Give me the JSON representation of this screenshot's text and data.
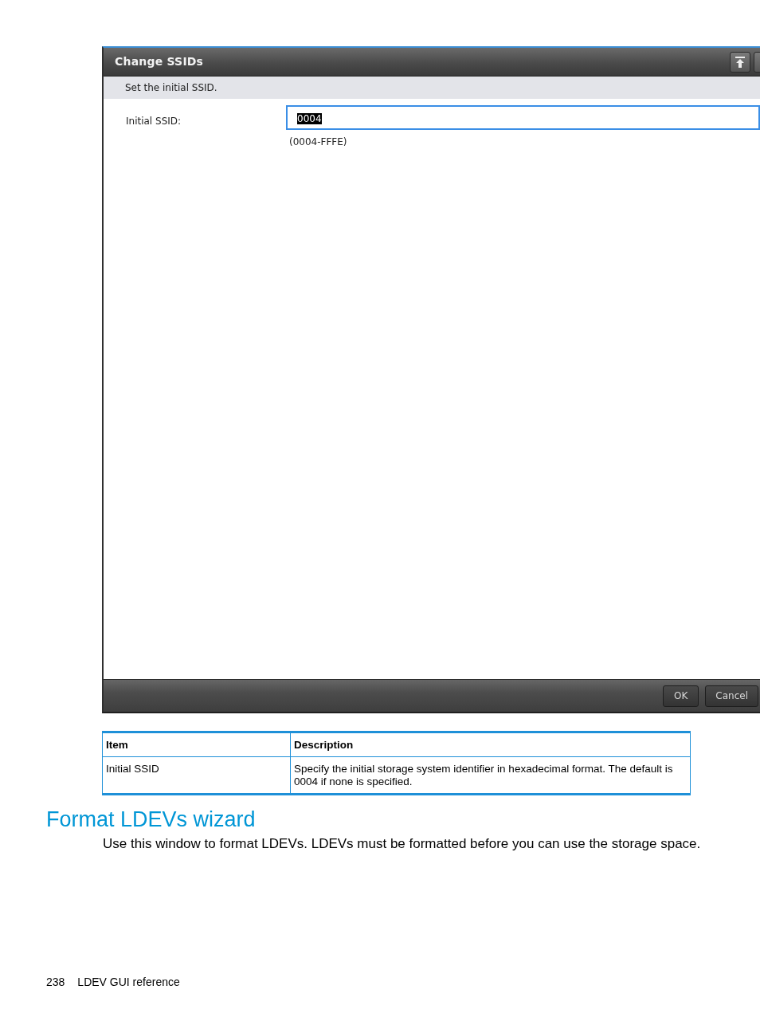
{
  "dialog": {
    "title": "Change SSIDs",
    "instruction": "Set the initial SSID.",
    "fields": [
      {
        "label": "Initial SSID:",
        "value": "0004",
        "value_selected": true,
        "focused": true,
        "hint": "(0004-FFFE)"
      }
    ],
    "buttons": [
      "OK",
      "Cancel"
    ]
  },
  "table": {
    "columns": [
      "Item",
      "Description"
    ],
    "rows": [
      [
        "Initial SSID",
        "Specify the initial storage system identifier in hexadecimal format. The default is 0004 if none is specified."
      ]
    ]
  },
  "section": {
    "heading": "Format LDEVs wizard",
    "text": "Use this window to format LDEVs. LDEVs must be formatted before you can use the storage space."
  },
  "footer": {
    "page_number": "238",
    "title": "LDEV GUI reference"
  }
}
